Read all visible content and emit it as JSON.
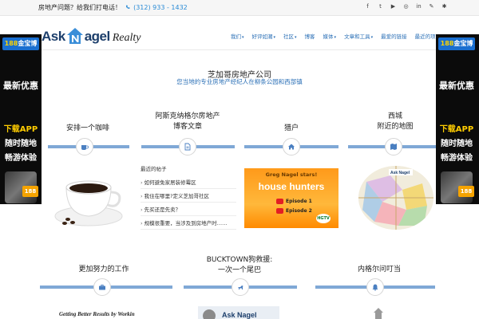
{
  "topbar": {
    "text": "房地产问题？给我们打电话！",
    "phone": "(312) 933 - 1432",
    "social": [
      "f",
      "t",
      "▶",
      "◎",
      "in",
      "✎",
      "✱"
    ]
  },
  "header": {
    "logo": {
      "ask": "Ask",
      "nagel": "agel",
      "realty": "Realty"
    },
    "nav": [
      {
        "label": "我们",
        "caret": "▾"
      },
      {
        "label": "好评如潮",
        "caret": "▾"
      },
      {
        "label": "社区",
        "caret": "▾"
      },
      {
        "label": "博客",
        "caret": ""
      },
      {
        "label": "媒体",
        "caret": "▾"
      },
      {
        "label": "文章和工具",
        "caret": "▾"
      },
      {
        "label": "最爱的链接",
        "caret": ""
      },
      {
        "label": "最近的项目",
        "caret": ""
      }
    ]
  },
  "ads": {
    "badge_num": "188",
    "badge_text": "金宝博",
    "line1": "最新优惠",
    "line2": "下载APP",
    "line3": "随时随地",
    "line4": "畅游体验",
    "phone_badge": "188"
  },
  "hero": {
    "company": "芝加哥房地产公司",
    "tagline": "您当地的专业房地产经纪人在柳条公园和西部镇"
  },
  "columns": [
    {
      "title_lines": [
        "安排一个咖啡"
      ],
      "icon": "coffee-icon"
    },
    {
      "title_lines": [
        "阿斯克纳格尔房地产",
        "博客文章"
      ],
      "icon": "document-icon"
    },
    {
      "title_lines": [
        "猎户"
      ],
      "icon": "home-icon"
    },
    {
      "title_lines": [
        "西城",
        "附近的地图"
      ],
      "icon": "map-icon"
    }
  ],
  "posts": {
    "title": "最近的帖子",
    "items": [
      "如何避免家居装修霉区",
      "我住在哪里?定义芝加哥社区",
      "先买还是先卖？",
      "规模很重要，当涉及到房地产时……"
    ]
  },
  "house_hunters": {
    "stars": "Greg Nagel stars!",
    "title_a": "house",
    "title_b": "hunters",
    "episode1": "Episode 1",
    "episode2": "Episode 2",
    "network": "HGTV"
  },
  "section2": [
    {
      "title_lines": [
        "更加努力的工作"
      ],
      "icon": "briefcase-icon"
    },
    {
      "title_lines": [
        "BUCKTOWN狗救援:",
        "一次一个尾巴"
      ],
      "icon": "dog-icon"
    },
    {
      "title_lines": [
        "内格尔问叮当"
      ],
      "icon": "bell-icon"
    }
  ],
  "bottom": {
    "book_text": "Getting Better Results by Workin"
  }
}
